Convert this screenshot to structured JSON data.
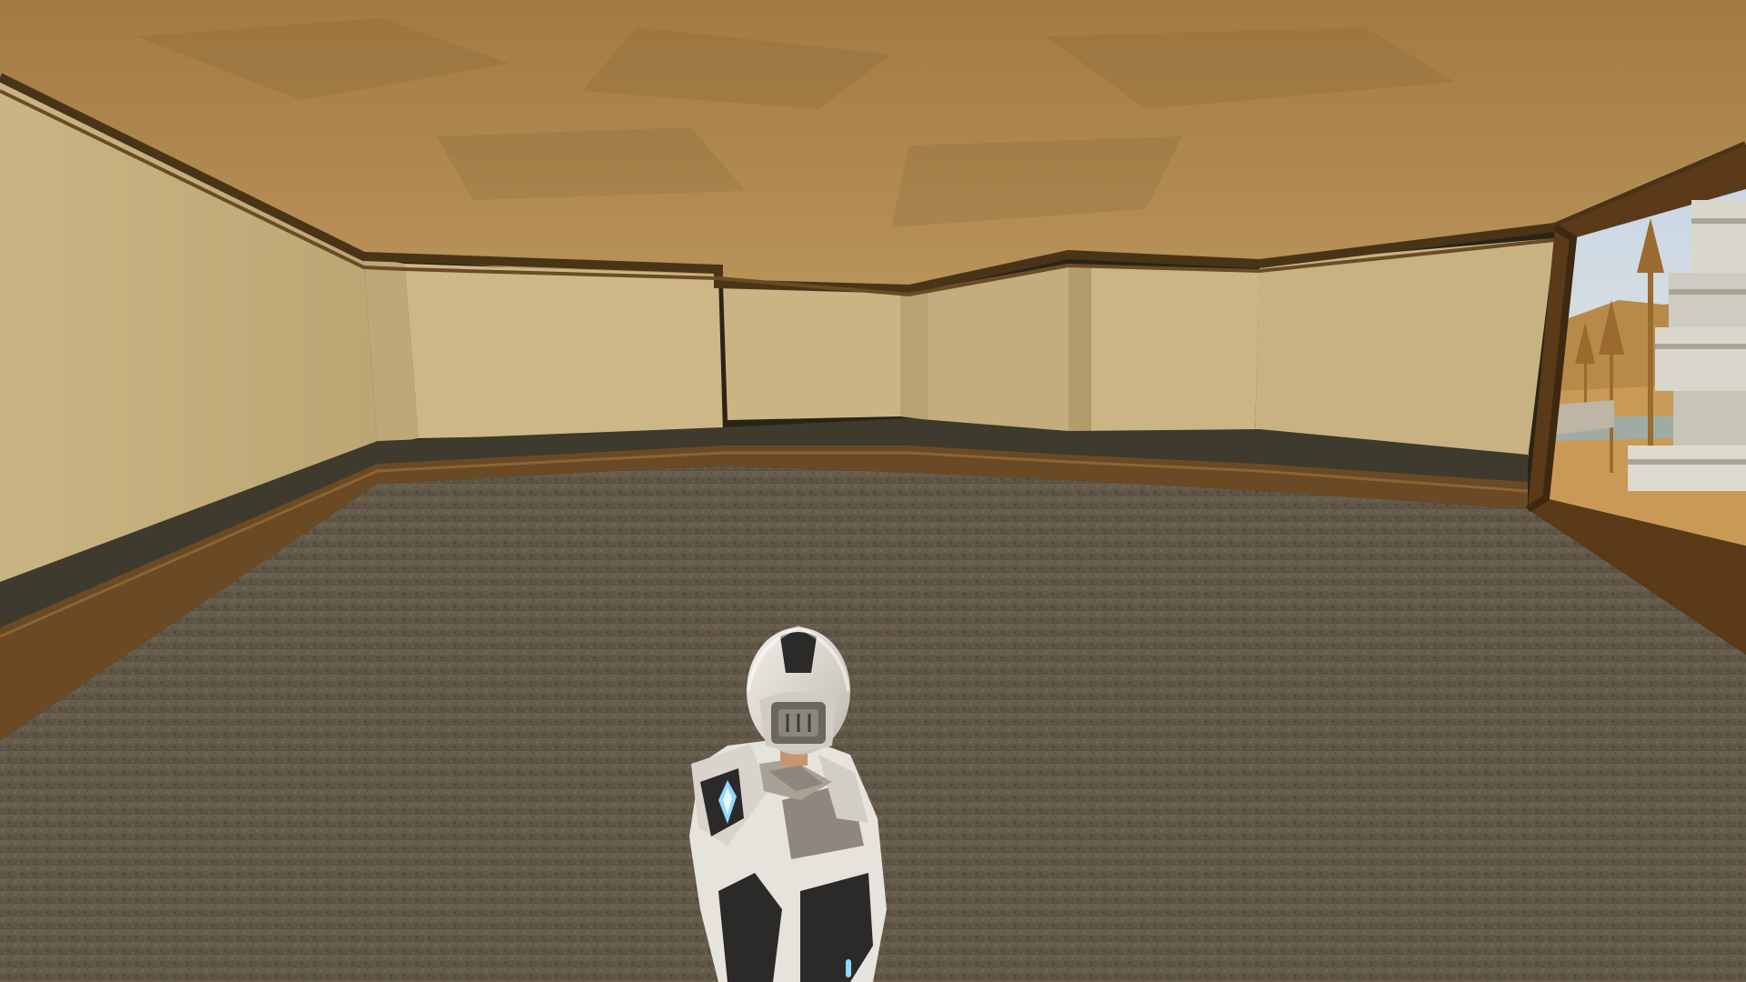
{
  "scene": {
    "type": "third-person-3d",
    "environment": "empty-interior-room",
    "hud_text": [],
    "colors": {
      "ceiling": "#a67f48",
      "ceiling_light": "#b8935a",
      "wall": "#cdb786",
      "wall_shade": "#b9a273",
      "wall_trim": "#4a3418",
      "baseboard_top": "#3f3a2c",
      "baseboard": "#6a4a24",
      "floor": "#6d6353",
      "floor_dark": "#4f473b",
      "window_frame": "#5a3a18",
      "sky": "#dbe3ea",
      "dunes": "#b78a4a",
      "building": "#d9d6cc",
      "armor_white": "#e6e2dc",
      "armor_dark": "#2c2a28",
      "armor_glow": "#8fd8ff"
    },
    "objects": {
      "player_character": "armored-player-character",
      "window": "room-window",
      "building_outside": "outdoor-building"
    }
  }
}
